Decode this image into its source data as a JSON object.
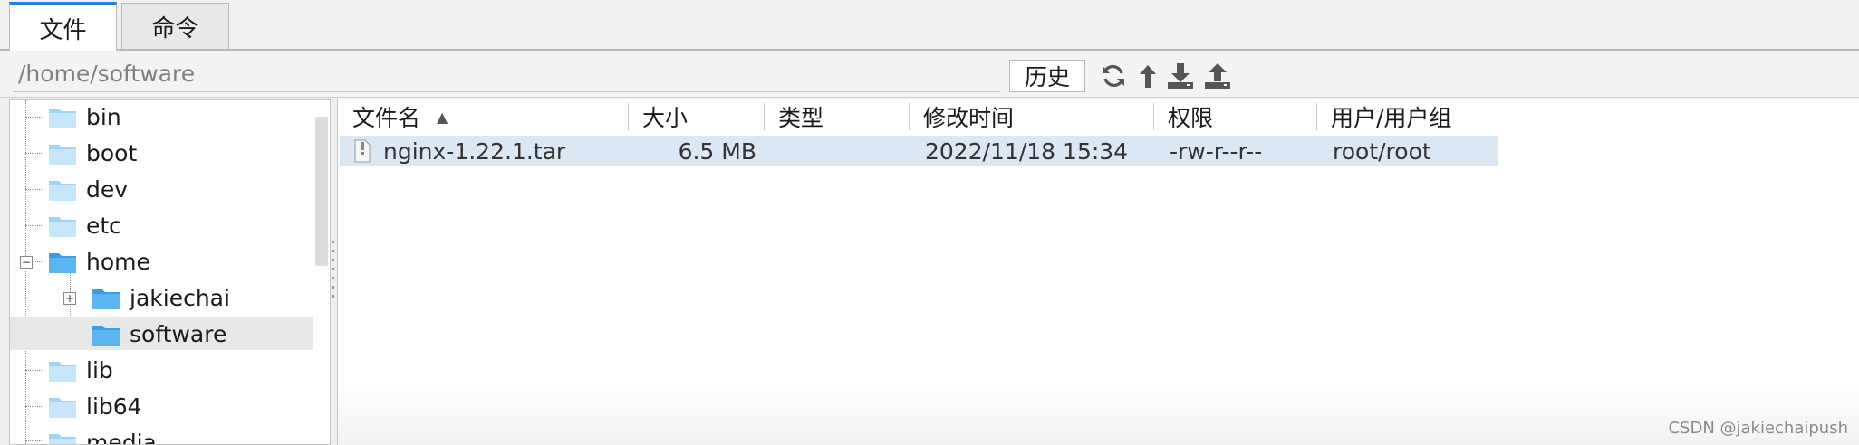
{
  "tabs": [
    {
      "label": "文件",
      "active": true
    },
    {
      "label": "命令",
      "active": false
    }
  ],
  "path_bar": {
    "path": "/home/software",
    "history_label": "历史"
  },
  "toolbar": {
    "icons": [
      "refresh-icon",
      "up-arrow-icon",
      "download-icon",
      "upload-icon"
    ]
  },
  "tree": {
    "items": [
      {
        "label": "bin"
      },
      {
        "label": "boot"
      },
      {
        "label": "dev"
      },
      {
        "label": "etc"
      },
      {
        "label": "home",
        "expanded": true
      },
      {
        "label": "jakiechai",
        "collapsed": true
      },
      {
        "label": "software",
        "selected": true
      },
      {
        "label": "lib"
      },
      {
        "label": "lib64"
      },
      {
        "label": "media"
      }
    ]
  },
  "file_list": {
    "columns": [
      "文件名",
      "大小",
      "类型",
      "修改时间",
      "权限",
      "用户/用户组"
    ],
    "sort_indicator": "▲",
    "rows": [
      {
        "name": "nginx-1.22.1.tar",
        "size": "6.5 MB",
        "type": "",
        "modified": "2022/11/18 15:34",
        "permissions": "-rw-r--r--",
        "owner": "root/root"
      }
    ]
  },
  "watermark": "CSDN @jakiechaipush",
  "colors": {
    "active_tab": "#2a7de1",
    "selected_row": "#dbe8f3",
    "folder": "#5bb6ef"
  }
}
